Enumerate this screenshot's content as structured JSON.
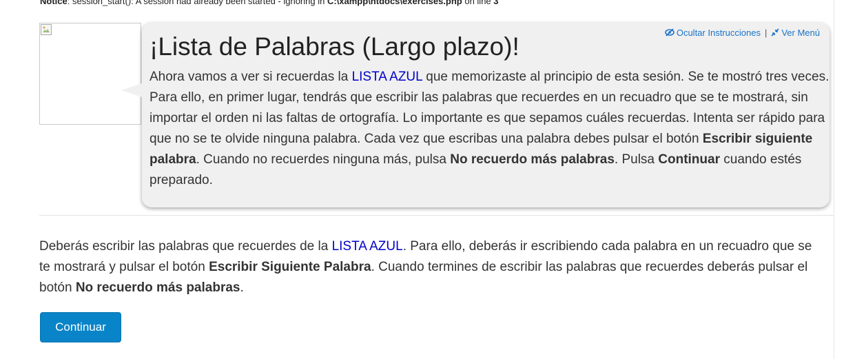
{
  "notice": {
    "label": "Notice",
    "text_a": ": session_start(): A session had already been started - ignoring in ",
    "path": "C:\\xampp\\htdocs\\exercises.php",
    "text_b": " on line ",
    "line": "3"
  },
  "bubble": {
    "hide_instructions": "Ocultar Instrucciones",
    "separator": "|",
    "view_menu": "Ver Menú",
    "title": "¡Lista de Palabras (Largo plazo)!",
    "p_1": "Ahora vamos a ver si recuerdas la ",
    "p_list": "LISTA AZUL",
    "p_2": " que memorizaste al principio de esta sesión. Se te mostró tres veces. Para ello, en primer lugar, tendrás que escribir las palabras que recuerdes en un recuadro que se te mostrará, sin importar el orden ni las faltas de ortografía. Lo importante es que sepamos cuáles recuerdas. Intenta ser rápido para que no se te olvide ninguna palabra. Cada vez que escribas una palabra debes pulsar el botón ",
    "p_bold_1": "Escribir siguiente palabra",
    "p_3": ". Cuando no recuerdes ninguna más, pulsa ",
    "p_bold_2": "No recuerdo más palabras",
    "p_4": ". Pulsa ",
    "p_bold_3": "Continuar",
    "p_5": " cuando estés preparado."
  },
  "main": {
    "t_1": "Deberás escribir las palabras que recuerdes de la ",
    "t_list": "LISTA AZUL",
    "t_2": ". Para ello, deberás ir escribiendo cada palabra en un recuadro que se te mostrará y pulsar el botón ",
    "t_bold_1": "Escribir Siguiente Palabra",
    "t_3": ". Cuando termines de escribir las palabras que recuerdes deberás pulsar el botón ",
    "t_bold_2": "No recuerdo más palabras",
    "t_4": "."
  },
  "continue_label": "Continuar",
  "icons": {
    "avatar": "broken-image-icon",
    "hide": "eye-slash-icon",
    "menu": "compress-arrows-icon"
  },
  "colors": {
    "link": "#1a73c8",
    "list_highlight": "#0000cc",
    "button": "#0a84c8",
    "bubble_bg": "#f0f0f0"
  }
}
